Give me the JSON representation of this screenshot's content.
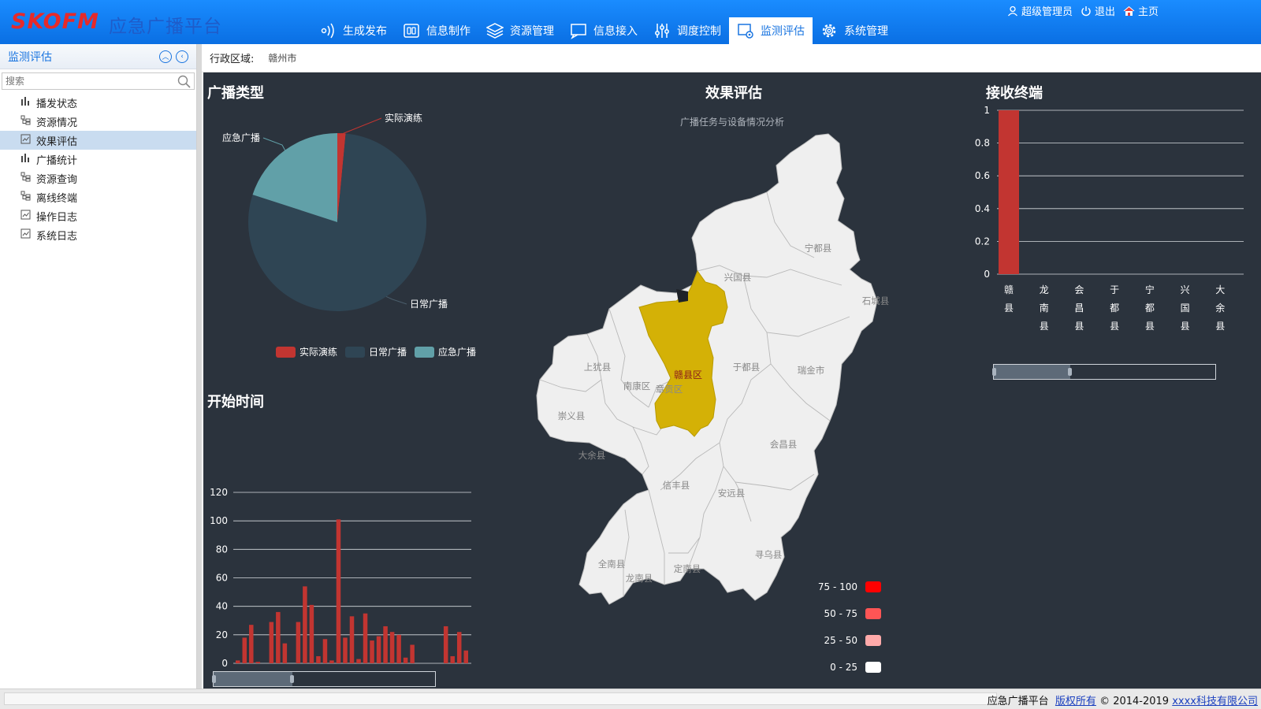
{
  "app": {
    "logo": "SKOFM",
    "title": "应急广播平台"
  },
  "userbar": {
    "user": "超级管理员",
    "logout": "退出",
    "home": "主页"
  },
  "nav": [
    {
      "label": "生成发布",
      "icon": "broadcast-icon"
    },
    {
      "label": "信息制作",
      "icon": "media-icon"
    },
    {
      "label": "资源管理",
      "icon": "layers-icon"
    },
    {
      "label": "信息接入",
      "icon": "monitor-icon"
    },
    {
      "label": "调度控制",
      "icon": "sliders-icon"
    },
    {
      "label": "监测评估",
      "icon": "monitor-gear-icon",
      "active": true
    },
    {
      "label": "系统管理",
      "icon": "gear-icon"
    }
  ],
  "sidebar": {
    "title": "监测评估",
    "search_placeholder": "搜索",
    "items": [
      {
        "label": "播发状态",
        "icon": "bar-chart-icon"
      },
      {
        "label": "资源情况",
        "icon": "tree-icon"
      },
      {
        "label": "效果评估",
        "icon": "report-icon",
        "active": true
      },
      {
        "label": "广播统计",
        "icon": "bar-chart-icon"
      },
      {
        "label": "资源查询",
        "icon": "tree-icon"
      },
      {
        "label": "离线终端",
        "icon": "tree-icon"
      },
      {
        "label": "操作日志",
        "icon": "report-icon"
      },
      {
        "label": "系统日志",
        "icon": "report-icon"
      }
    ]
  },
  "filter": {
    "label": "行政区域:",
    "value": "赣州市"
  },
  "panels": {
    "pie_title": "广播类型",
    "time_title": "开始时间",
    "map_title": "效果评估",
    "map_subtitle": "广播任务与设备情况分析",
    "terminal_title": "接收终端"
  },
  "colors": {
    "red": "#c23531",
    "navy": "#2f4554",
    "teal": "#61a0a8",
    "dash_bg": "#2b333d",
    "map_highlight": "#d4b106",
    "map_fill": "#efefef"
  },
  "chart_data": [
    {
      "type": "pie",
      "title": "广播类型",
      "slices": [
        {
          "name": "实际演练",
          "value": 1.5
        },
        {
          "name": "日常广播",
          "value": 78.5
        },
        {
          "name": "应急广播",
          "value": 20
        }
      ],
      "legend": [
        "实际演练",
        "日常广播",
        "应急广播"
      ],
      "legend_position": "bottom"
    },
    {
      "type": "bar",
      "title": "开始时间",
      "ylim": [
        0,
        120
      ],
      "yticks": [
        0,
        20,
        40,
        60,
        80,
        100,
        120
      ],
      "values": [
        2,
        18,
        27,
        1,
        0,
        29,
        36,
        14,
        0,
        29,
        54,
        41,
        5,
        17,
        2,
        101,
        18,
        33,
        3,
        35,
        16,
        19,
        26,
        22,
        20,
        4,
        13,
        0,
        0,
        0,
        0,
        26,
        5,
        22,
        9
      ],
      "grid": true
    },
    {
      "type": "bar",
      "title": "接收终端",
      "categories": [
        "赣县",
        "龙南县",
        "会昌县",
        "于都县",
        "宁都县",
        "兴国县",
        "大余县"
      ],
      "values": [
        1,
        0,
        0,
        0,
        0,
        0,
        0
      ],
      "ylim": [
        0,
        1
      ],
      "yticks": [
        0,
        0.2,
        0.4,
        0.6,
        0.8,
        1
      ],
      "grid": true
    }
  ],
  "map": {
    "highlight": "赣县区",
    "regions": [
      "宁都县",
      "兴国县",
      "石城县",
      "于都县",
      "瑞金市",
      "上犹县",
      "南康区",
      "章贡区",
      "崇义县",
      "大余县",
      "会昌县",
      "信丰县",
      "安远县",
      "寻乌县",
      "全南县",
      "龙南县",
      "定南县"
    ],
    "legend": [
      {
        "label": "75 - 100",
        "color": "#ff0000"
      },
      {
        "label": "50 - 75",
        "color": "#ff5555"
      },
      {
        "label": "25 - 50",
        "color": "#ffaaaa"
      },
      {
        "label": "0 - 25",
        "color": "#ffffff"
      }
    ]
  },
  "footer": {
    "platform": "应急广播平台",
    "rights": "版权所有",
    "copyright": "© 2014-2019",
    "company": "xxxx科技有限公司"
  }
}
